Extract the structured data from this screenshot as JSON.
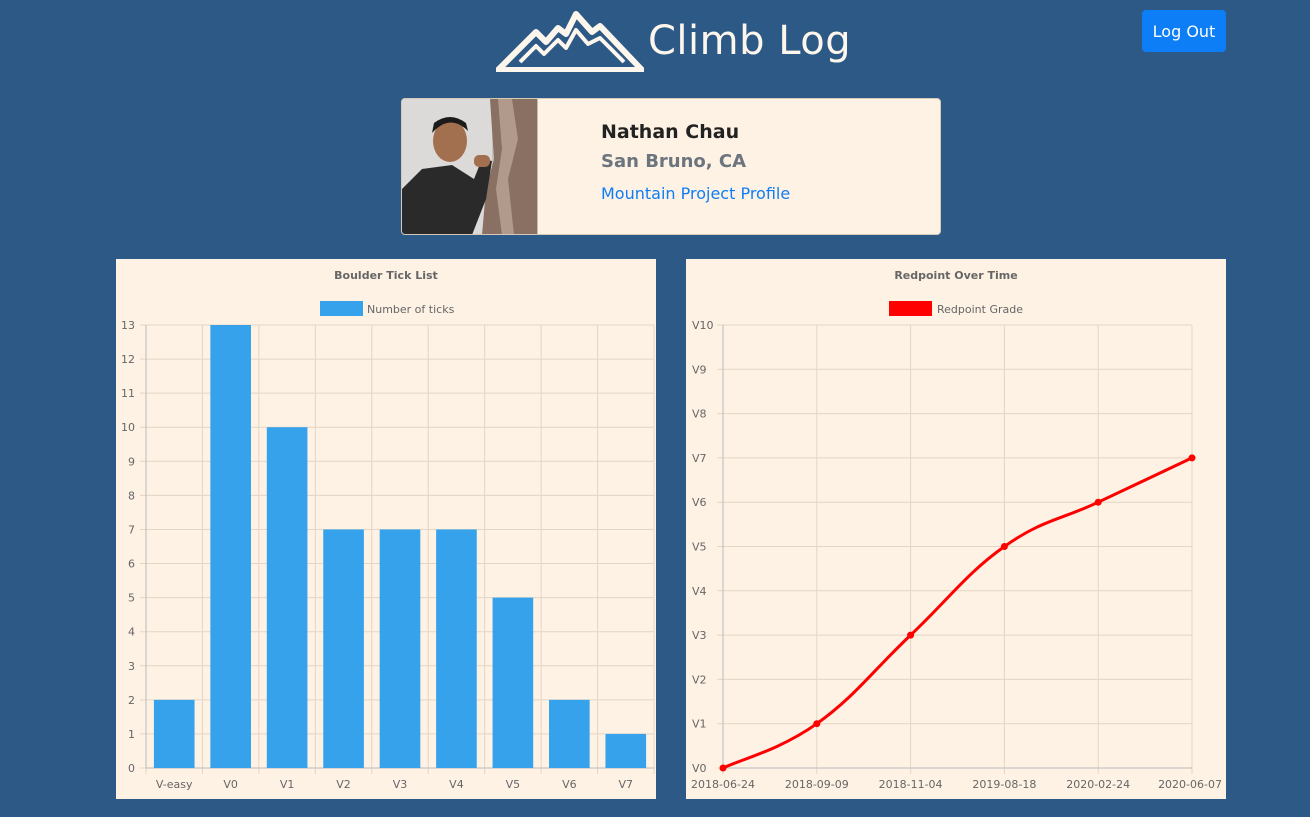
{
  "app": {
    "title": "Climb Log",
    "logo_icon": "mountain-icon",
    "logout_label": "Log Out"
  },
  "profile": {
    "name": "Nathan Chau",
    "location": "San Bruno, CA",
    "link_label": "Mountain Project Profile"
  },
  "colors": {
    "background": "#2d5986",
    "panel": "#fef2e5",
    "button": "#0d7ef5",
    "bar": "#36a2eb",
    "line": "#ff0000"
  },
  "chart_data": [
    {
      "type": "bar",
      "title": "Boulder Tick List",
      "xlabel": "",
      "ylabel": "",
      "legend_position": "top",
      "grid": true,
      "categories": [
        "V-easy",
        "V0",
        "V1",
        "V2",
        "V3",
        "V4",
        "V5",
        "V6",
        "V7"
      ],
      "series": [
        {
          "name": "Number of ticks",
          "values": [
            2,
            13,
            10,
            7,
            7,
            7,
            5,
            2,
            1
          ]
        }
      ],
      "ylim": [
        0,
        13
      ],
      "yticks": [
        "0",
        "1",
        "2",
        "3",
        "4",
        "5",
        "6",
        "7",
        "8",
        "9",
        "10",
        "11",
        "12",
        "13"
      ]
    },
    {
      "type": "line",
      "title": "Redpoint Over Time",
      "xlabel": "",
      "ylabel": "",
      "legend_position": "top",
      "grid": true,
      "x": [
        "2018-06-24",
        "2018-09-09",
        "2018-11-04",
        "2019-08-18",
        "2020-02-24",
        "2020-06-07"
      ],
      "series": [
        {
          "name": "Redpoint Grade",
          "values": [
            "V0",
            "V1",
            "V3",
            "V5",
            "V6",
            "V7"
          ]
        }
      ],
      "ylim": [
        "V0",
        "V10"
      ],
      "yticks": [
        "V0",
        "V1",
        "V2",
        "V3",
        "V4",
        "V5",
        "V6",
        "V7",
        "V8",
        "V9",
        "V10"
      ]
    }
  ]
}
